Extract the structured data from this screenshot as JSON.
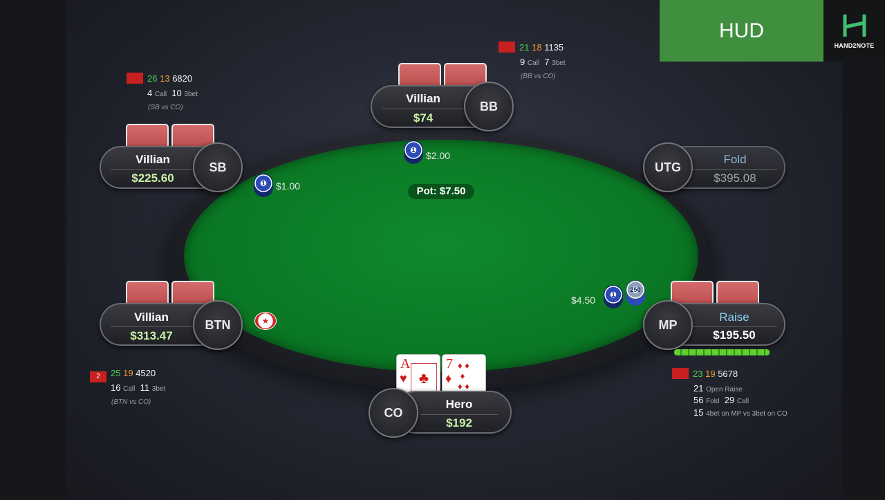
{
  "hud": {
    "label": "HUD",
    "brand": "HAND2NOTE"
  },
  "pot": "Pot: $7.50",
  "seats": {
    "bb": {
      "name": "Villian",
      "stack": "$74",
      "position": "BB"
    },
    "sb": {
      "name": "Villian",
      "stack": "$225.60",
      "position": "SB"
    },
    "utg": {
      "name": "Fold",
      "stack": "$395.08",
      "position": "UTG"
    },
    "btn": {
      "name": "Villian",
      "stack": "$313.47",
      "position": "BTN"
    },
    "mp": {
      "name": "Raise",
      "stack": "$195.50",
      "position": "MP"
    },
    "co": {
      "name": "Hero",
      "stack": "$192",
      "position": "CO"
    }
  },
  "bets": {
    "bb": "$2.00",
    "sb": "$1.00",
    "mp": "$4.50"
  },
  "chips": {
    "one": "1",
    "big": "250"
  },
  "hero_cards": [
    {
      "rank": "A",
      "suit": "♥",
      "color": "#d01b1b"
    },
    {
      "rank": "7",
      "suit": "♦",
      "color": "#d01b1b"
    }
  ],
  "dealer_symbol": "★",
  "stats": {
    "bb": {
      "s1": "21",
      "s2": "18",
      "s3": "1135",
      "n1": "9",
      "l1": "Call",
      "n2": "7",
      "l2": "3bet",
      "ctx": "(BB vs CO)"
    },
    "sb": {
      "s1": "26",
      "s2": "13",
      "s3": "6820",
      "n1": "4",
      "l1": "Call",
      "n2": "10",
      "l2": "3bet",
      "ctx": "(SB vs CO)"
    },
    "btn": {
      "badge": "2",
      "s1": "25",
      "s2": "19",
      "s3": "4520",
      "n1": "16",
      "l1": "Call",
      "n2": "11",
      "l2": "3bet",
      "ctx": "(BTN vs CO)"
    },
    "mp": {
      "s1": "23",
      "s2": "19",
      "s3": "5678",
      "n1": "21",
      "l1": "Open Raise",
      "n2": "56",
      "l2": "Fold",
      "n3": "29",
      "l3": "Call",
      "n4": "15",
      "l4": "4bet on MP vs 3bet on CO"
    }
  },
  "colors": {
    "felt": "#0b7a25",
    "stack": "#c8f0a6",
    "hud_green": "#3f8f3f",
    "vpip": "#4fd04f",
    "pfr": "#f0a030",
    "badge": "#c62020"
  }
}
